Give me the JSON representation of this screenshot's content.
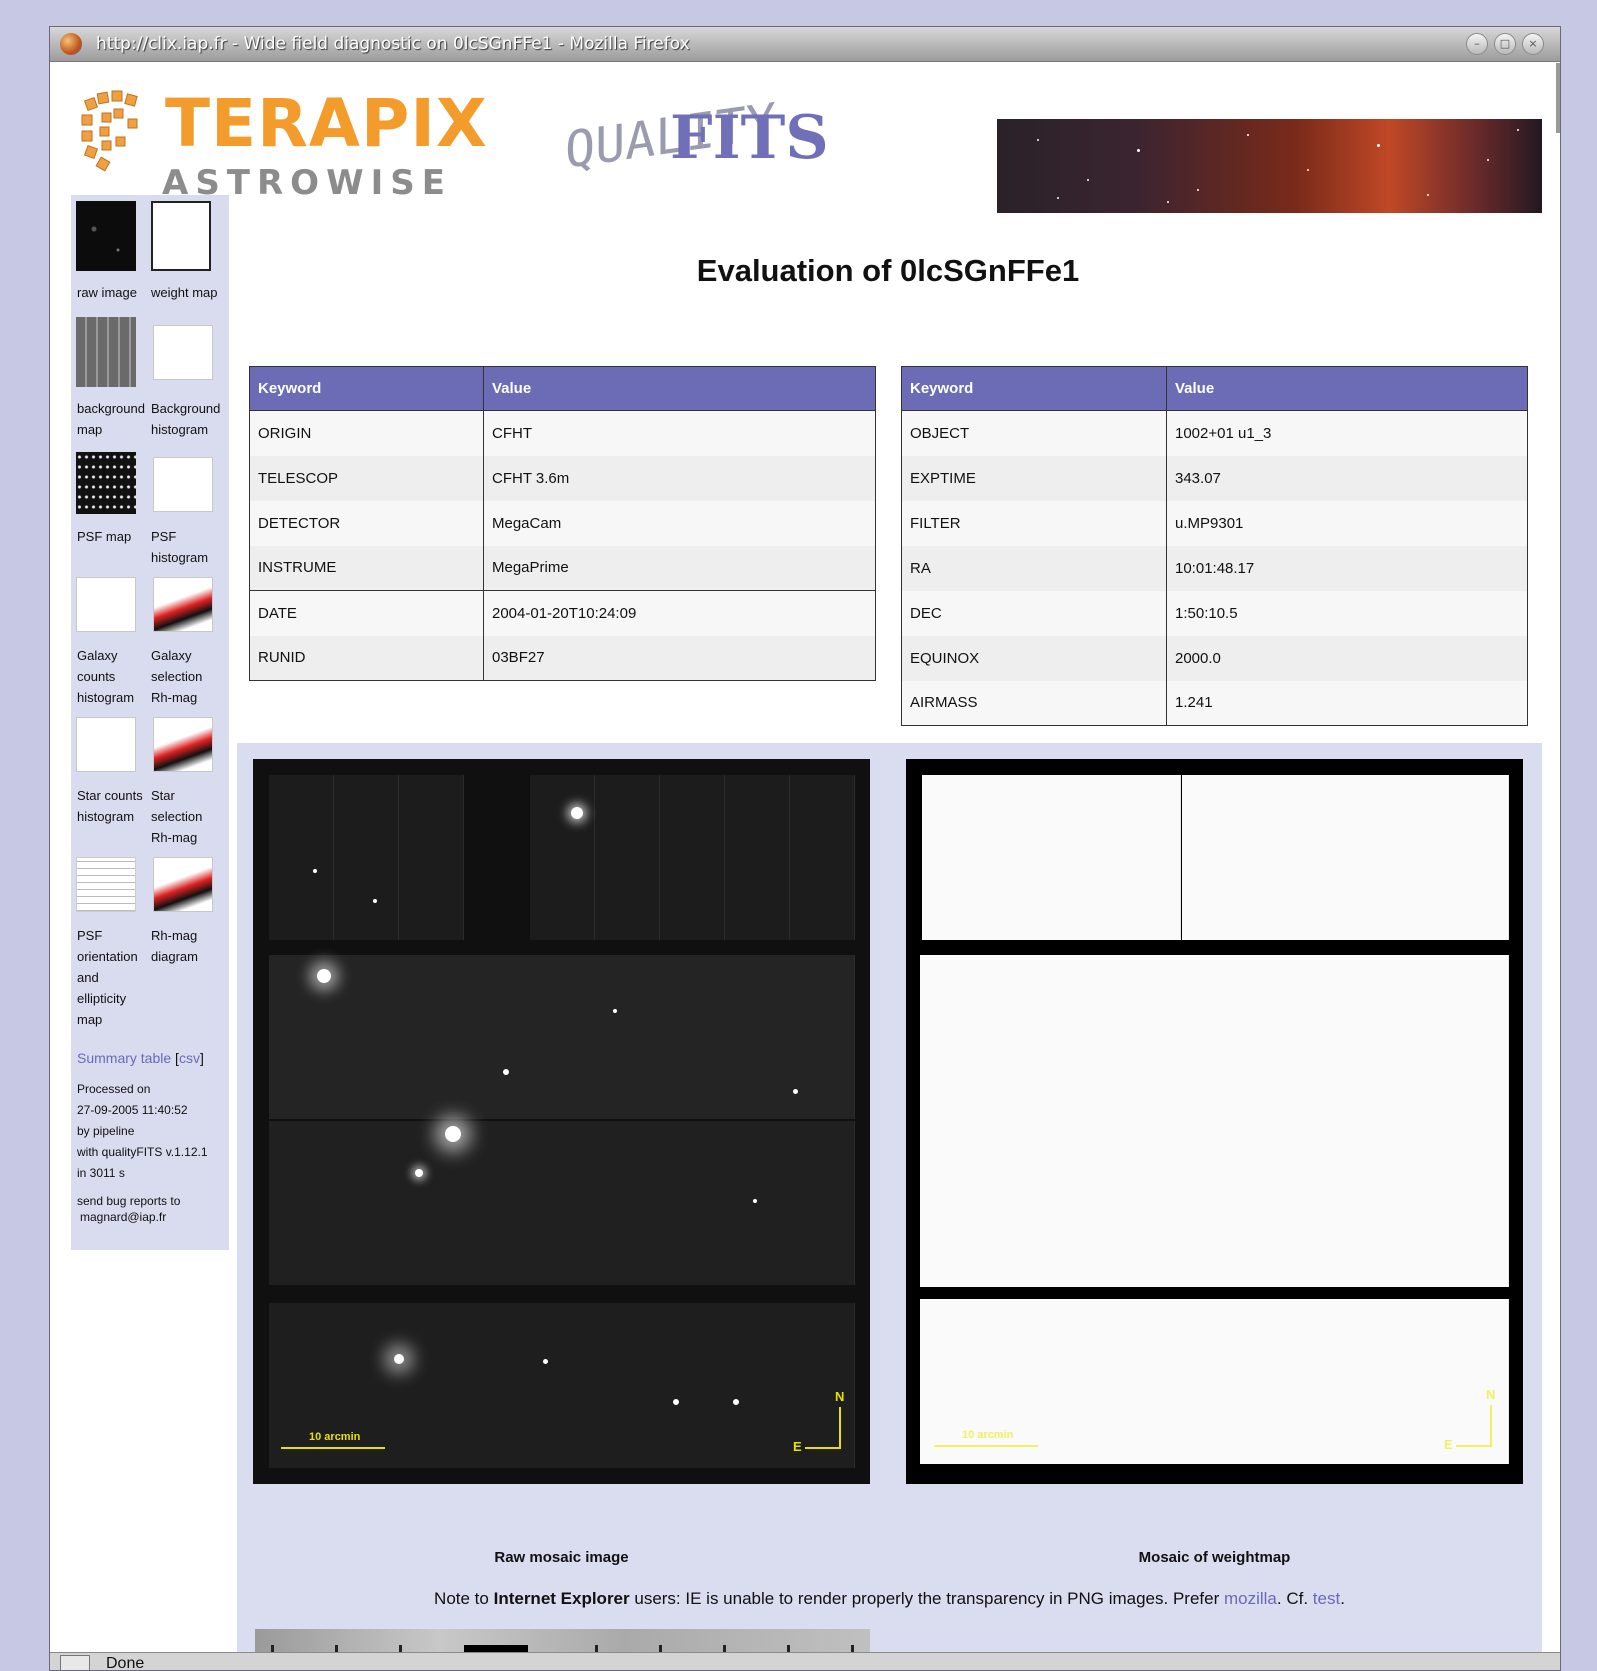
{
  "window": {
    "title": "http://clix.iap.fr - Wide field diagnostic on 0lcSGnFFe1 - Mozilla Firefox"
  },
  "header": {
    "logo_terapix": "TERAPIX",
    "logo_astrowise": "ASTROWISE",
    "logo_quality": "QUALITY",
    "logo_fits": "FITS"
  },
  "sidebar": {
    "items": [
      {
        "label": "raw image"
      },
      {
        "label": "weight map"
      },
      {
        "label": "background map"
      },
      {
        "label": "Background histogram"
      },
      {
        "label": "PSF map"
      },
      {
        "label": "PSF histogram"
      },
      {
        "label": "Galaxy counts histogram"
      },
      {
        "label": "Galaxy selection Rh-mag"
      },
      {
        "label": "Star counts histogram"
      },
      {
        "label": "Star selection Rh-mag"
      },
      {
        "label": "PSF orientation and ellipticity map"
      },
      {
        "label": "Rh-mag diagram"
      }
    ],
    "summary_link": "Summary table",
    "csv_bracket_open": "[",
    "csv_link": "csv",
    "csv_bracket_close": "]",
    "processed": [
      "Processed on",
      "27-09-2005 11:40:52",
      "by pipeline",
      "with qualityFITS v.1.12.1",
      "in 3011 s"
    ],
    "bug_report": [
      "send bug reports to",
      "magnard@iap.fr"
    ]
  },
  "main": {
    "title": "Evaluation of 0lcSGnFFe1",
    "table_left": {
      "headers": [
        "Keyword",
        "Value"
      ],
      "rows": [
        [
          "ORIGIN",
          "CFHT"
        ],
        [
          "TELESCOP",
          "CFHT 3.6m"
        ],
        [
          "DETECTOR",
          "MegaCam"
        ],
        [
          "INSTRUME",
          "MegaPrime"
        ],
        [
          "DATE",
          "2004-01-20T10:24:09"
        ],
        [
          "RUNID",
          "03BF27"
        ]
      ]
    },
    "table_right": {
      "headers": [
        "Keyword",
        "Value"
      ],
      "rows": [
        [
          "OBJECT",
          "1002+01 u1_3"
        ],
        [
          "EXPTIME",
          "343.07"
        ],
        [
          "FILTER",
          "u.MP9301"
        ],
        [
          "RA",
          "10:01:48.17"
        ],
        [
          "DEC",
          "1:50:10.5"
        ],
        [
          "EQUINOX",
          "2000.0"
        ],
        [
          "AIRMASS",
          "1.241"
        ]
      ]
    },
    "raw_mosaic": {
      "caption": "Raw mosaic image",
      "scale_label": "10 arcmin",
      "compass_n": "N",
      "compass_e": "E"
    },
    "weight_mosaic": {
      "caption": "Mosaic of weightmap",
      "scale_label": "10 arcmin",
      "compass_n": "N",
      "compass_e": "E"
    },
    "note": {
      "prefix": "Note to ",
      "ie": "Internet Explorer",
      "middle": " users: IE is unable to render properly the transparency in PNG images. Prefer ",
      "mozilla": "mozilla",
      "cf": ". Cf. ",
      "test": "test",
      "end": "."
    }
  },
  "statusbar": {
    "text": "Done"
  }
}
